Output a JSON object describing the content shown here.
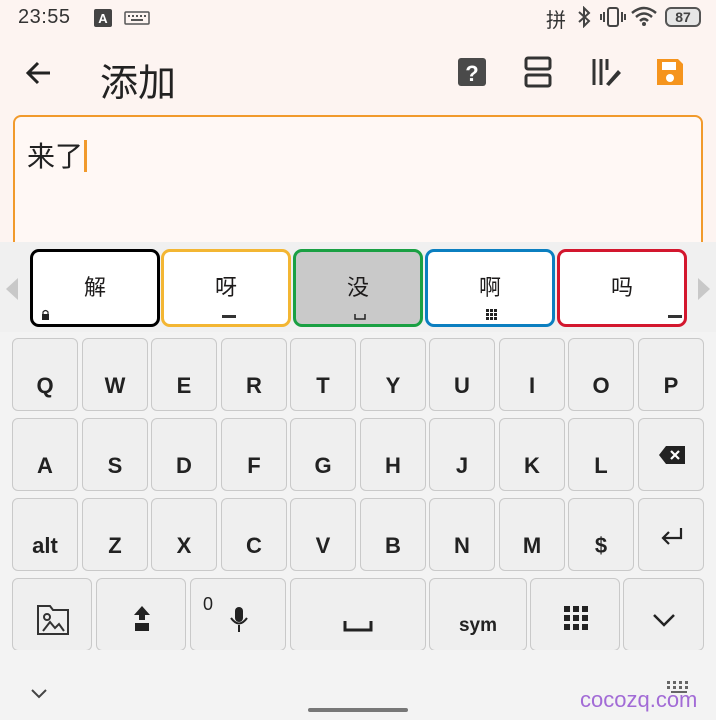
{
  "status": {
    "time": "23:55",
    "battery": "87",
    "icons": [
      "a-box-icon",
      "keyboard-icon",
      "pinyin-icon",
      "bluetooth-icon",
      "vibrate-icon",
      "wifi-icon"
    ],
    "pinyin_label": "拼"
  },
  "appbar": {
    "title": "添加",
    "actions": [
      "help-icon",
      "layout-icon",
      "edit-columns-icon",
      "save-icon"
    ],
    "save_color": "#f5941d"
  },
  "editor": {
    "text": "来了",
    "accent": "#f19a2c"
  },
  "candidates": [
    {
      "text": "解",
      "border": "#000000",
      "bg": "#ffffff",
      "mark": "lock-icon"
    },
    {
      "text": "呀",
      "border": "#f3b633",
      "bg": "#ffffff",
      "mark": "ctrl-icon"
    },
    {
      "text": "没",
      "border": "#1aa043",
      "bg": "#c9c9c9",
      "mark": "space-icon"
    },
    {
      "text": "啊",
      "border": "#0b7fc0",
      "bg": "#ffffff",
      "mark": "grid-icon"
    },
    {
      "text": "吗",
      "border": "#d3172e",
      "bg": "#ffffff",
      "mark": "alt-icon"
    }
  ],
  "keyboard": {
    "row1": [
      "Q",
      "W",
      "E",
      "R",
      "T",
      "Y",
      "U",
      "I",
      "O",
      "P"
    ],
    "row2": [
      "A",
      "S",
      "D",
      "F",
      "G",
      "H",
      "J",
      "K",
      "L"
    ],
    "row3": [
      "alt",
      "Z",
      "X",
      "C",
      "V",
      "B",
      "N",
      "M",
      "$"
    ],
    "mic_sub": "0",
    "sym": "sym"
  },
  "watermark": "cocozq.com"
}
